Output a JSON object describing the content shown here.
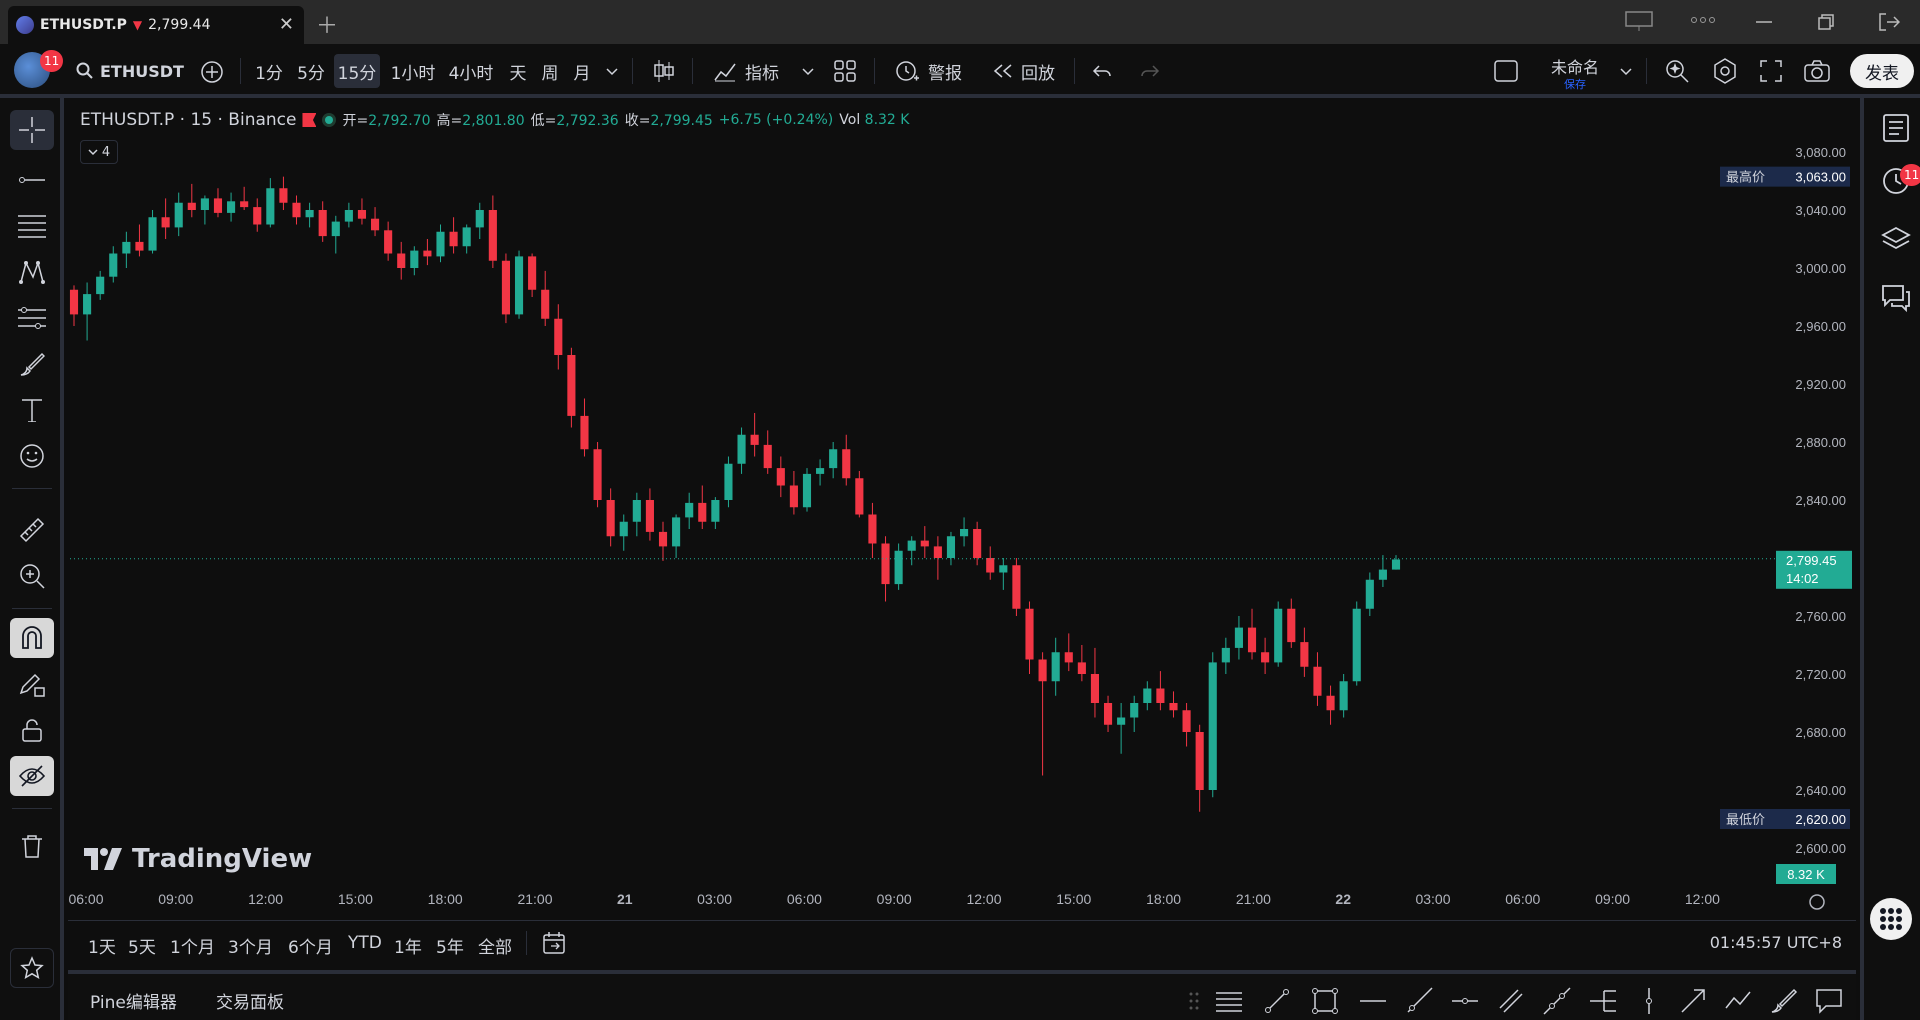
{
  "browser": {
    "tab_title": "ETHUSDT.P",
    "tab_arrow": "▼",
    "tab_price": "2,799.44",
    "tab_close": "✕",
    "new_tab": "＋"
  },
  "toolbar": {
    "avatar_badge": "11",
    "symbol": "ETHUSDT",
    "intervals": [
      "1分",
      "5分",
      "15分",
      "1小时",
      "4小时",
      "天",
      "周",
      "月"
    ],
    "active_interval": "15分",
    "indicators_label": "指标",
    "alert_label": "警报",
    "replay_label": "回放",
    "layout_name": "未命名",
    "layout_sub": "保存",
    "publish_label": "发表"
  },
  "legend": {
    "symbol_line": "ETHUSDT.P · 15 · Binance",
    "open_label": "开=",
    "open": "2,792.70",
    "high_label": "高=",
    "high": "2,801.80",
    "low_label": "低=",
    "low": "2,792.36",
    "close_label": "收=",
    "close": "2,799.45",
    "change": "+6.75 (+0.24%)",
    "vol_label": "Vol",
    "vol": "8.32 K",
    "indicators_count": "4"
  },
  "price_axis": {
    "ticks": [
      "3,080.00",
      "3,040.00",
      "3,000.00",
      "2,960.00",
      "2,920.00",
      "2,880.00",
      "2,840.00",
      "2,800.00",
      "2,760.00",
      "2,720.00",
      "2,680.00",
      "2,640.00",
      "2,600.00"
    ],
    "high_label": "最高价",
    "high_value": "3,063.00",
    "low_label": "最低价",
    "low_value": "2,620.00",
    "last_price": "2,799.45",
    "countdown": "14:02",
    "volume_tag": "8.32 K"
  },
  "time_axis": {
    "ticks": [
      "06:00",
      "09:00",
      "12:00",
      "15:00",
      "18:00",
      "21:00",
      "21",
      "03:00",
      "06:00",
      "09:00",
      "12:00",
      "15:00",
      "18:00",
      "21:00",
      "22",
      "03:00",
      "06:00",
      "09:00",
      "12:00"
    ]
  },
  "ranges": [
    "1天",
    "5天",
    "1个月",
    "3个月",
    "6个月",
    "YTD",
    "1年",
    "5年",
    "全部"
  ],
  "clock": "01:45:57 UTC+8",
  "bottom_tabs": [
    "Pine编辑器",
    "交易面板"
  ],
  "right_badge": "11",
  "watermark": "TradingView",
  "colors": {
    "up": "#22ab94",
    "down": "#f23645",
    "background": "#0e0e0e",
    "panel": "#0f0f0f",
    "border": "#2a2e39",
    "label_bg": "#1c2a4a"
  },
  "chart_data": {
    "type": "candlestick",
    "symbol": "ETHUSDT.P",
    "interval": "15",
    "exchange": "Binance",
    "ylim": [
      2590,
      3100
    ],
    "x_start_label": "06:00",
    "candles_ohlc": [
      [
        2985,
        2988,
        2960,
        2968
      ],
      [
        2968,
        2990,
        2950,
        2982
      ],
      [
        2982,
        2998,
        2978,
        2994
      ],
      [
        2994,
        3015,
        2990,
        3010
      ],
      [
        3010,
        3025,
        3000,
        3018
      ],
      [
        3018,
        3030,
        3008,
        3012
      ],
      [
        3012,
        3040,
        3010,
        3035
      ],
      [
        3035,
        3048,
        3020,
        3028
      ],
      [
        3028,
        3052,
        3022,
        3045
      ],
      [
        3045,
        3058,
        3035,
        3040
      ],
      [
        3040,
        3050,
        3030,
        3048
      ],
      [
        3048,
        3055,
        3035,
        3038
      ],
      [
        3038,
        3052,
        3032,
        3046
      ],
      [
        3046,
        3056,
        3040,
        3042
      ],
      [
        3042,
        3048,
        3025,
        3030
      ],
      [
        3030,
        3062,
        3028,
        3055
      ],
      [
        3055,
        3063,
        3040,
        3045
      ],
      [
        3045,
        3050,
        3030,
        3035
      ],
      [
        3035,
        3045,
        3028,
        3040
      ],
      [
        3040,
        3046,
        3018,
        3022
      ],
      [
        3022,
        3036,
        3010,
        3032
      ],
      [
        3032,
        3045,
        3028,
        3040
      ],
      [
        3040,
        3048,
        3030,
        3034
      ],
      [
        3034,
        3042,
        3022,
        3026
      ],
      [
        3026,
        3032,
        3005,
        3010
      ],
      [
        3010,
        3018,
        2992,
        3000
      ],
      [
        3000,
        3015,
        2995,
        3012
      ],
      [
        3012,
        3020,
        3002,
        3008
      ],
      [
        3008,
        3030,
        3004,
        3025
      ],
      [
        3025,
        3035,
        3010,
        3015
      ],
      [
        3015,
        3030,
        3010,
        3028
      ],
      [
        3028,
        3045,
        3020,
        3040
      ],
      [
        3040,
        3050,
        3000,
        3005
      ],
      [
        3005,
        3010,
        2962,
        2968
      ],
      [
        2968,
        3012,
        2965,
        3008
      ],
      [
        3008,
        3010,
        2980,
        2985
      ],
      [
        2985,
        2998,
        2960,
        2965
      ],
      [
        2965,
        2975,
        2930,
        2940
      ],
      [
        2940,
        2945,
        2890,
        2898
      ],
      [
        2898,
        2910,
        2870,
        2875
      ],
      [
        2875,
        2880,
        2835,
        2840
      ],
      [
        2840,
        2848,
        2808,
        2815
      ],
      [
        2815,
        2830,
        2805,
        2825
      ],
      [
        2825,
        2845,
        2815,
        2840
      ],
      [
        2840,
        2848,
        2812,
        2818
      ],
      [
        2818,
        2825,
        2798,
        2808
      ],
      [
        2808,
        2830,
        2800,
        2828
      ],
      [
        2828,
        2845,
        2820,
        2838
      ],
      [
        2838,
        2850,
        2820,
        2825
      ],
      [
        2825,
        2842,
        2820,
        2840
      ],
      [
        2840,
        2870,
        2835,
        2865
      ],
      [
        2865,
        2890,
        2858,
        2885
      ],
      [
        2885,
        2900,
        2870,
        2878
      ],
      [
        2878,
        2888,
        2858,
        2862
      ],
      [
        2862,
        2870,
        2842,
        2850
      ],
      [
        2850,
        2860,
        2830,
        2835
      ],
      [
        2835,
        2862,
        2832,
        2858
      ],
      [
        2858,
        2868,
        2850,
        2862
      ],
      [
        2862,
        2880,
        2855,
        2875
      ],
      [
        2875,
        2885,
        2850,
        2855
      ],
      [
        2855,
        2860,
        2828,
        2830
      ],
      [
        2830,
        2838,
        2800,
        2810
      ],
      [
        2810,
        2815,
        2770,
        2782
      ],
      [
        2782,
        2810,
        2778,
        2805
      ],
      [
        2805,
        2815,
        2795,
        2812
      ],
      [
        2812,
        2822,
        2800,
        2808
      ],
      [
        2808,
        2815,
        2785,
        2800
      ],
      [
        2800,
        2818,
        2795,
        2815
      ],
      [
        2815,
        2828,
        2808,
        2820
      ],
      [
        2820,
        2825,
        2795,
        2800
      ],
      [
        2800,
        2808,
        2785,
        2790
      ],
      [
        2790,
        2800,
        2778,
        2795
      ],
      [
        2795,
        2800,
        2760,
        2765
      ],
      [
        2765,
        2770,
        2720,
        2730
      ],
      [
        2730,
        2735,
        2650,
        2715
      ],
      [
        2715,
        2745,
        2705,
        2735
      ],
      [
        2735,
        2748,
        2722,
        2728
      ],
      [
        2728,
        2740,
        2715,
        2720
      ],
      [
        2720,
        2738,
        2690,
        2700
      ],
      [
        2700,
        2705,
        2680,
        2685
      ],
      [
        2685,
        2700,
        2665,
        2690
      ],
      [
        2690,
        2705,
        2680,
        2700
      ],
      [
        2700,
        2715,
        2695,
        2710
      ],
      [
        2710,
        2722,
        2695,
        2700
      ],
      [
        2700,
        2708,
        2690,
        2695
      ],
      [
        2695,
        2700,
        2670,
        2680
      ],
      [
        2680,
        2685,
        2625,
        2640
      ],
      [
        2640,
        2735,
        2635,
        2728
      ],
      [
        2728,
        2745,
        2720,
        2738
      ],
      [
        2738,
        2760,
        2730,
        2752
      ],
      [
        2752,
        2765,
        2730,
        2735
      ],
      [
        2735,
        2745,
        2720,
        2728
      ],
      [
        2728,
        2770,
        2725,
        2765
      ],
      [
        2765,
        2772,
        2738,
        2742
      ],
      [
        2742,
        2752,
        2718,
        2725
      ],
      [
        2725,
        2735,
        2698,
        2705
      ],
      [
        2705,
        2712,
        2685,
        2695
      ],
      [
        2695,
        2720,
        2690,
        2715
      ],
      [
        2715,
        2770,
        2712,
        2765
      ],
      [
        2765,
        2790,
        2760,
        2785
      ],
      [
        2785,
        2802,
        2780,
        2792
      ],
      [
        2792,
        2802,
        2792,
        2799
      ]
    ]
  }
}
